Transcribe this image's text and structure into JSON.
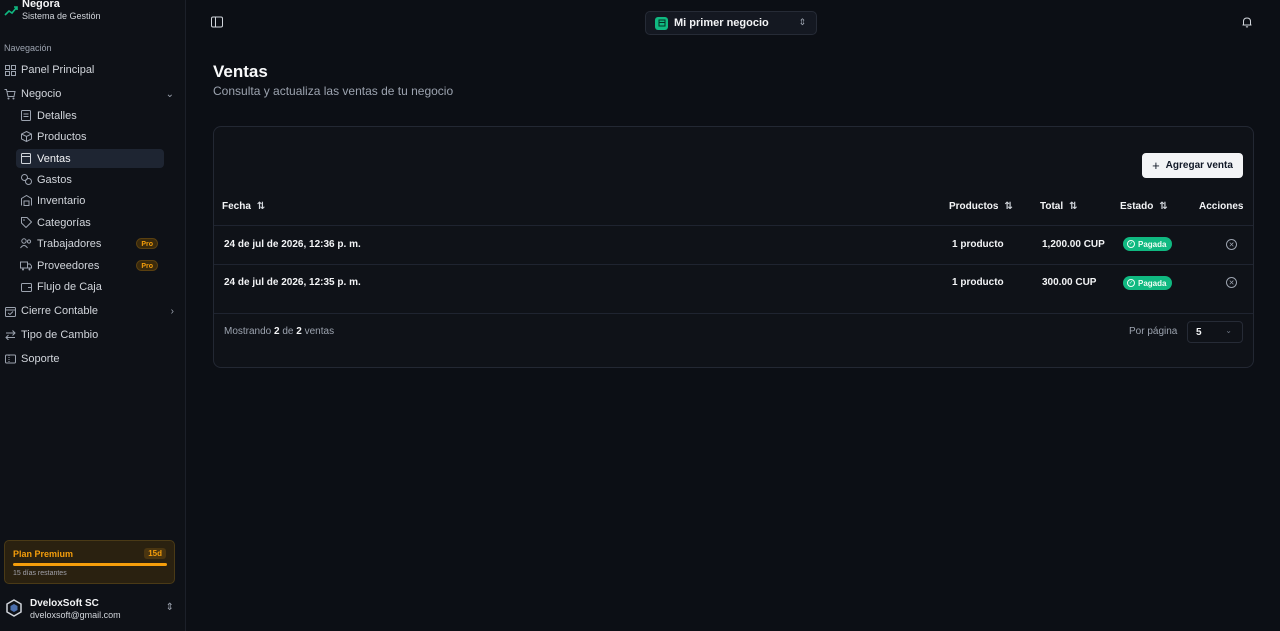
{
  "brand": {
    "name": "Negora",
    "subtitle": "Sistema de Gestión"
  },
  "nav": {
    "section_label": "Navegación",
    "panel_principal": "Panel Principal",
    "negocio": "Negocio",
    "sub_items": [
      {
        "label": "Detalles"
      },
      {
        "label": "Productos"
      },
      {
        "label": "Ventas"
      },
      {
        "label": "Gastos"
      },
      {
        "label": "Inventario"
      },
      {
        "label": "Categorías"
      },
      {
        "label": "Trabajadores",
        "badge": "Pro"
      },
      {
        "label": "Proveedores",
        "badge": "Pro"
      },
      {
        "label": "Flujo de Caja"
      }
    ],
    "cierre_contable": "Cierre Contable",
    "tipo_cambio": "Tipo de Cambio",
    "soporte": "Soporte"
  },
  "plan": {
    "title": "Plan Premium",
    "badge": "15d",
    "remaining": "15 días restantes",
    "progress": 1.0
  },
  "user": {
    "name": "DveloxSoft SC",
    "email": "dveloxsoft@gmail.com"
  },
  "header": {
    "business": "Mi primer negocio"
  },
  "page": {
    "title": "Ventas",
    "subtitle": "Consulta y actualiza las ventas de tu negocio"
  },
  "toolbar": {
    "add_label": "Agregar venta"
  },
  "table": {
    "headers": {
      "fecha": "Fecha",
      "productos": "Productos",
      "total": "Total",
      "estado": "Estado",
      "acciones": "Acciones"
    },
    "rows": [
      {
        "fecha": "24 de jul de 2026, 12:36 p. m.",
        "productos": "1 producto",
        "total": "1,200.00 CUP",
        "estado": "Pagada"
      },
      {
        "fecha": "24 de jul de 2026, 12:35 p. m.",
        "productos": "1 producto",
        "total": "300.00 CUP",
        "estado": "Pagada"
      }
    ]
  },
  "footer": {
    "showing_prefix": "Mostrando",
    "shown": "2",
    "of": "de",
    "total": "2",
    "suffix": "ventas",
    "per_page_label": "Por página",
    "per_page_value": "5"
  },
  "colors": {
    "accent_green": "#10b981",
    "premium": "#f59e0b",
    "background": "#0c0f15"
  }
}
